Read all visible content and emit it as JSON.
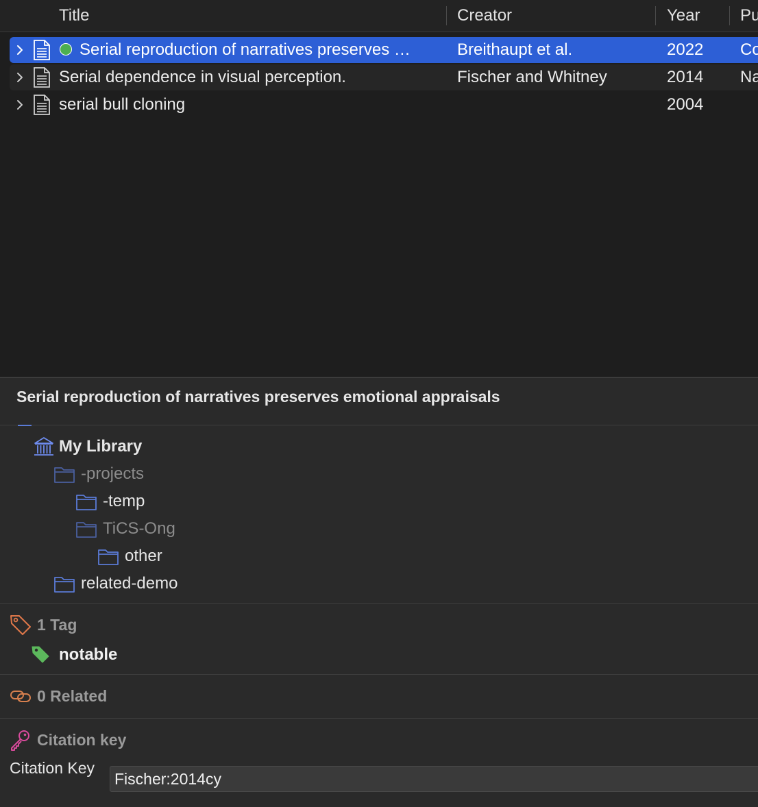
{
  "columns": {
    "title": "Title",
    "creator": "Creator",
    "year": "Year",
    "publication": "Pu"
  },
  "items": [
    {
      "title": "Serial reproduction of narratives preserves …",
      "creator": "Breithaupt et al.",
      "year": "2022",
      "publication": "Co",
      "selected": true,
      "has_dot": true
    },
    {
      "title": "Serial dependence in visual perception.",
      "creator": "Fischer and Whitney",
      "year": "2014",
      "publication": "Na",
      "selected": false,
      "has_dot": false
    },
    {
      "title": "serial bull cloning",
      "creator": "",
      "year": "2004",
      "publication": "",
      "selected": false,
      "has_dot": false
    }
  ],
  "item_pane": {
    "title": "Serial reproduction of narratives preserves emotional appraisals",
    "collections": {
      "library": "My Library",
      "items": [
        {
          "label": "-projects",
          "dim": true
        },
        {
          "label": "-temp",
          "dim": false
        },
        {
          "label": "TiCS-Ong",
          "dim": true
        },
        {
          "label": "other",
          "dim": false
        },
        {
          "label": "related-demo",
          "dim": false
        }
      ]
    },
    "tags": {
      "heading": "1 Tag",
      "items": [
        "notable"
      ]
    },
    "related": {
      "heading": "0 Related"
    },
    "citation": {
      "heading": "Citation key",
      "field_label": "Citation Key",
      "value": "Fischer:2014cy"
    }
  },
  "colors": {
    "selection": "#2d5fd6",
    "folder": "#5a7bd6",
    "tag_green": "#5cb85c",
    "tag_section_orange": "#e0784a",
    "citation_key_pink": "#d94b9c",
    "status_dot": "#4caf50"
  },
  "icons": {
    "row_toggle": "chevron-right-icon",
    "item_type": "document-icon",
    "library": "library-icon",
    "collection": "folder-icon",
    "tags_section": "tag-outline-icon",
    "tag": "tag-filled-icon",
    "related_section": "link-icon",
    "citation_section": "key-icon"
  }
}
